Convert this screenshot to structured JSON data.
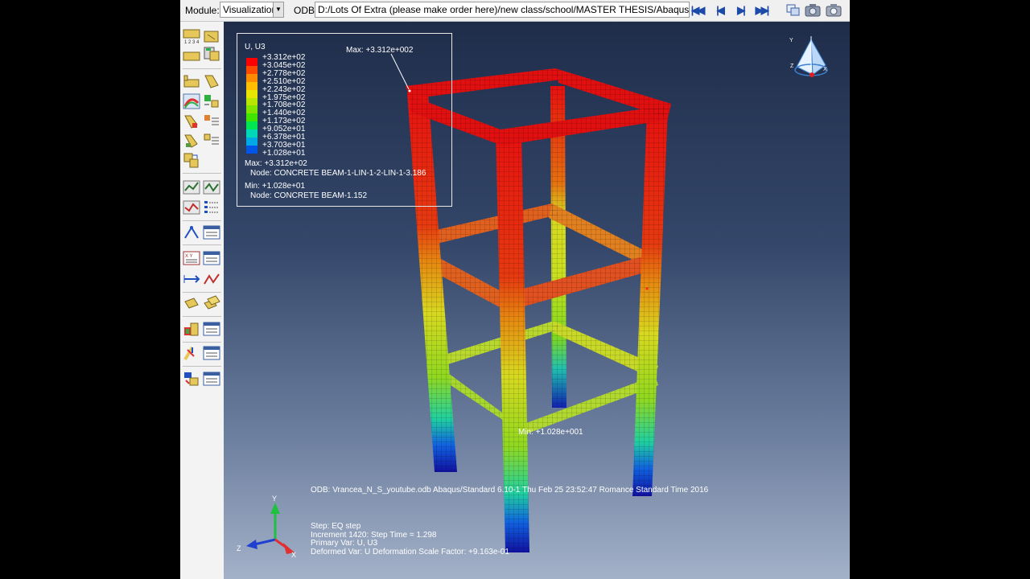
{
  "toolbar": {
    "module_label": "Module:",
    "module_value": "Visualization",
    "odb_label": "ODB:",
    "odb_path": "D:/Lots Of Extra (please make order here)/new class/school/MASTER THESIS/Abaqus files/Vrancea"
  },
  "legend": {
    "title": "U, U3",
    "values": [
      "+3.312e+02",
      "+3.045e+02",
      "+2.778e+02",
      "+2.510e+02",
      "+2.243e+02",
      "+1.975e+02",
      "+1.708e+02",
      "+1.440e+02",
      "+1.173e+02",
      "+9.052e+01",
      "+6.378e+01",
      "+3.703e+01",
      "+1.028e+01"
    ],
    "colors": [
      "#ff0000",
      "#ff4a00",
      "#ff8c00",
      "#ffbf00",
      "#e6e600",
      "#b8e600",
      "#80e600",
      "#40e600",
      "#00e650",
      "#00d9b8",
      "#00a8e6",
      "#0055e6",
      "#0000d9"
    ],
    "max_line": "Max: +3.312e+02",
    "max_node": "Node: CONCRETE BEAM-1-LIN-1-2-LIN-1-3.186",
    "min_line": "Min: +1.028e+01",
    "min_node": "Node: CONCRETE BEAM-1.152"
  },
  "viewport": {
    "max_annotation": "Max: +3.312e+002",
    "min_annotation": "Min: +1.028e+001",
    "odb_info": "ODB: Vrancea_N_S_youtube.odb     Abaqus/Standard 6.10-1     Thu Feb 25 23:52:47 Romance Standard Time 2016",
    "status": {
      "step": "Step: EQ step",
      "increment": "Increment    1420: Step Time =     1.298",
      "primary_var": "Primary Var: U, U3",
      "deformed_var": "Deformed Var: U   Deformation Scale Factor: +9.163e-01"
    },
    "triad": {
      "y": "Y",
      "z": "Z",
      "x": "X"
    }
  }
}
